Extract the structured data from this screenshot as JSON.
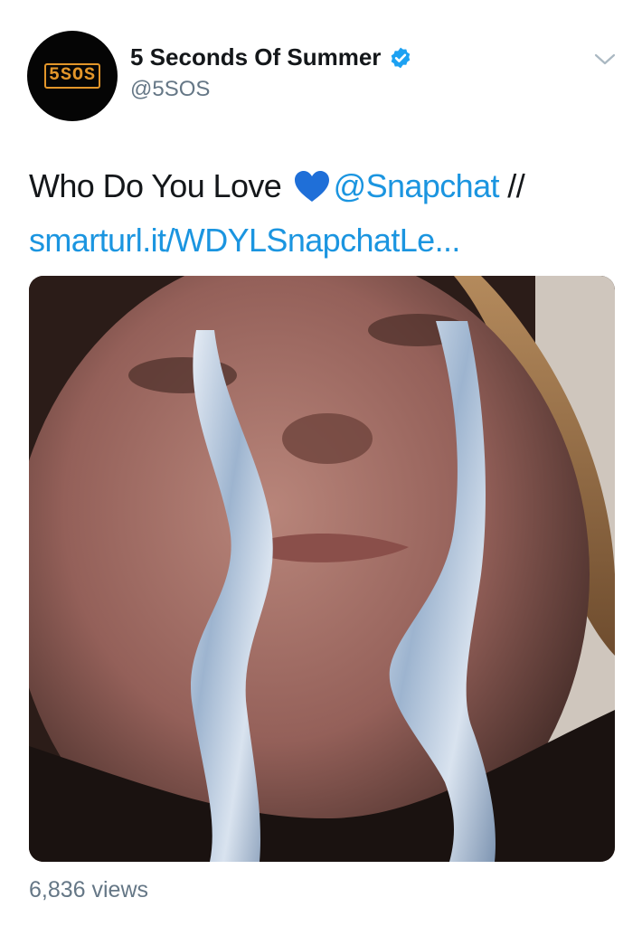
{
  "header": {
    "avatar_logo": "5SOS",
    "display_name": "5 Seconds Of Summer",
    "handle": "@5SOS",
    "verified_icon": "verified-badge-icon",
    "menu_icon": "chevron-down-icon"
  },
  "tweet": {
    "text_before": "Who Do You Love",
    "emoji": "blue-heart-emoji",
    "mention": "@Snapchat",
    "separator": " //",
    "url": "smarturl.it/WDYLSnapchatLe..."
  },
  "media": {
    "type": "video",
    "description_icon": "video-thumbnail"
  },
  "footer": {
    "views": "6,836 views"
  },
  "colors": {
    "link": "#1b95e0",
    "secondary_text": "#657786",
    "primary_text": "#14171a",
    "verified": "#1da1f2",
    "logo": "#e3962a"
  }
}
